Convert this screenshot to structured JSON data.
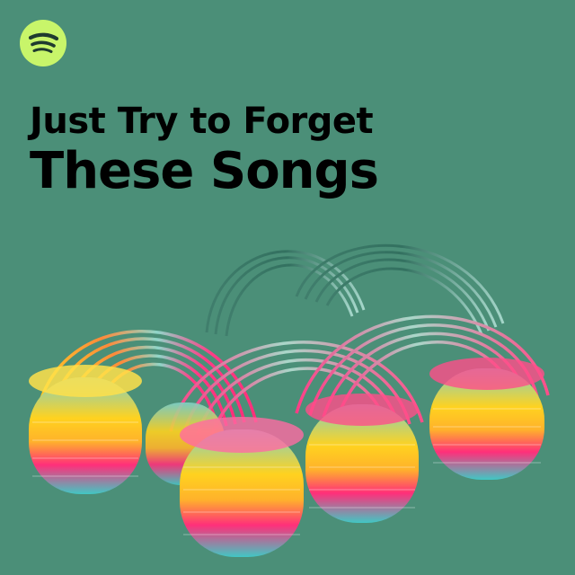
{
  "colors": {
    "background": "#4b8f78",
    "brand": "#1ed760",
    "text": "#000000"
  },
  "brand": {
    "icon": "spotify-icon"
  },
  "playlist": {
    "title_line1": "Just Try to Forget",
    "title_line2": "These Songs"
  },
  "artwork": {
    "subject": "slinky-spring-icon"
  }
}
